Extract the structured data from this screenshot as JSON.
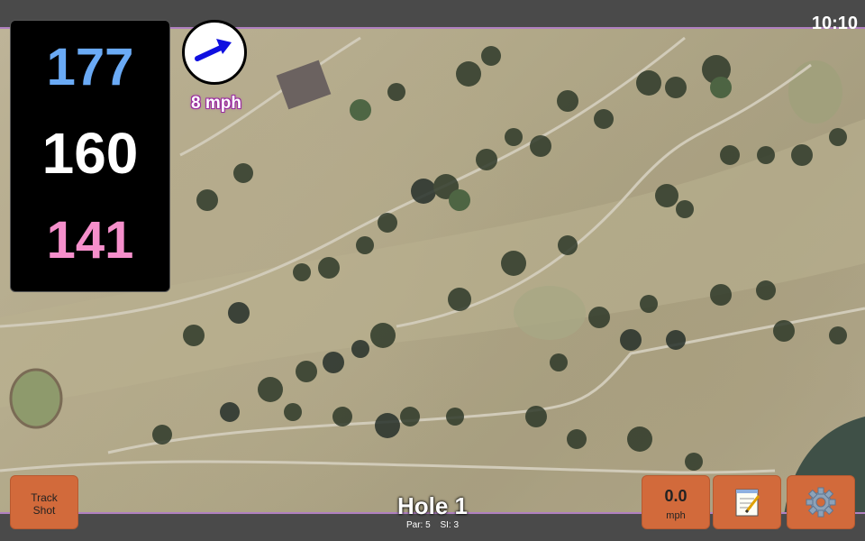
{
  "clock": "10:10",
  "distances": {
    "back": "177",
    "middle": "160",
    "front": "141"
  },
  "wind": {
    "speed_label": "8 mph"
  },
  "buttons": {
    "track_shot_line1": "Track",
    "track_shot_line2": "Shot",
    "speed_value": "0.0",
    "speed_unit": "mph",
    "notes_icon": "notepad-icon",
    "settings_icon": "gear-icon"
  },
  "hole": {
    "title": "Hole 1",
    "par": "Par: 5",
    "si": "SI: 3"
  },
  "colors": {
    "back_distance": "#6aaaf5",
    "middle_distance": "#ffffff",
    "front_distance": "#f58fcb",
    "button_bg": "#d26a3b",
    "wind_arrow": "#1010e0"
  }
}
